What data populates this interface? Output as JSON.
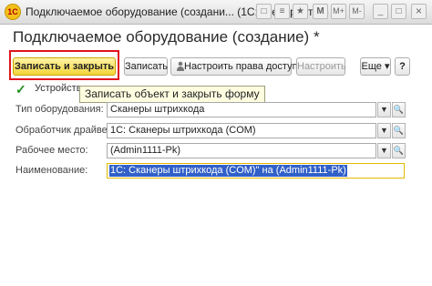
{
  "window": {
    "title": "Подключаемое оборудование (создани...  (1С:Предприятие)",
    "app_icon_text": "1С",
    "controls": [
      "□",
      "≡",
      "★",
      "M",
      "M+",
      "M-",
      "_",
      "□",
      "×"
    ]
  },
  "form": {
    "title": "Подключаемое оборудование (создание) *"
  },
  "toolbar": {
    "save_close_label": "Записать и закрыть",
    "save_label": "Записать",
    "access_label": "Настроить права доступа",
    "configure_label": "Настроить",
    "more_label": "Еще",
    "more_arrow": "▾"
  },
  "tooltip": "Записать объект и закрыть форму",
  "device_used": {
    "label": "Устройство",
    "checked": true
  },
  "fields": {
    "equipment_type": {
      "label": "Тип оборудования:",
      "value": "Сканеры штрихкода"
    },
    "driver_handler": {
      "label": "Обработчик драйвера:",
      "value": "1С: Сканеры штрихкода (COM)"
    },
    "workplace": {
      "label": "Рабочее место:",
      "value": "(Admin1111-Pk)"
    },
    "name": {
      "label": "Наименование:",
      "value": "1С: Сканеры штрихкода (COM)\" на (Admin1111-Pk)"
    }
  },
  "colors": {
    "primary_button": "#f3d53a",
    "highlight_frame": "#e0141c",
    "selection": "#3060c8",
    "tooltip_bg": "#fffde0"
  }
}
